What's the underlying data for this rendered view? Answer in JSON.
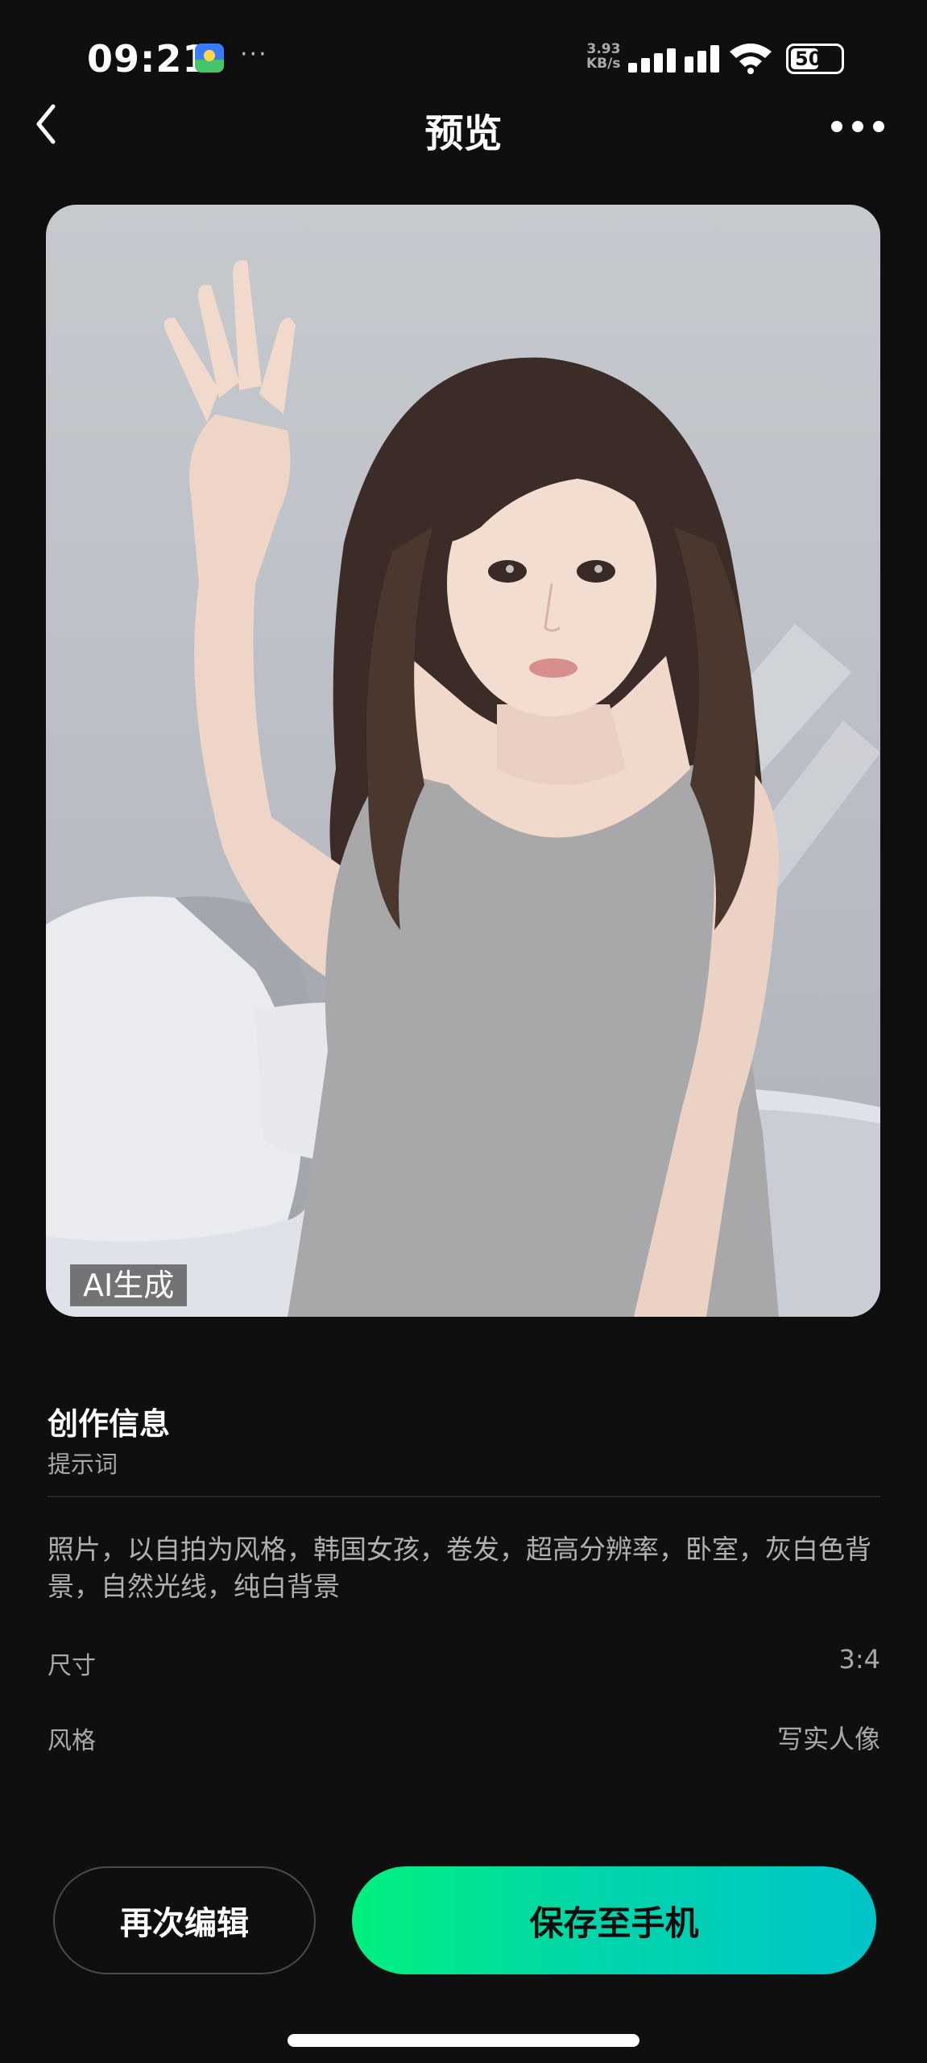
{
  "status_bar": {
    "time": "09:21",
    "app_icon": "gallery-app-icon",
    "more_notifications": "···",
    "network_speed_value": "3.93",
    "network_speed_unit": "KB/s",
    "battery_level": "50"
  },
  "nav": {
    "title": "预览",
    "back_icon": "chevron-left-icon",
    "more_icon": "more-horizontal-icon"
  },
  "image": {
    "badge": "AI生成"
  },
  "info": {
    "title": "创作信息",
    "subtitle": "提示词",
    "prompt": "照片，以自拍为风格，韩国女孩，卷发，超高分辨率，卧室，灰白色背景，自然光线，纯白背景",
    "size_label": "尺寸",
    "size_value": "3:4",
    "style_label": "风格",
    "style_value": "写实人像"
  },
  "actions": {
    "edit_again": "再次编辑",
    "save_to_phone": "保存至手机"
  },
  "colors": {
    "background": "#0f0f0f",
    "save_gradient_start": "#00f07e",
    "save_gradient_end": "#00c4c8"
  }
}
